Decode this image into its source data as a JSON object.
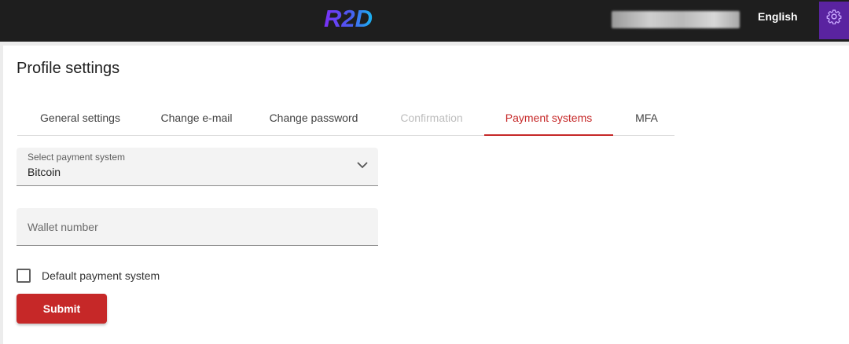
{
  "header": {
    "logo_text": "R2D",
    "language": "English",
    "settings_icon": "gear-icon",
    "accent_color": "#5a23a0"
  },
  "page": {
    "title": "Profile settings"
  },
  "tabs": [
    {
      "label": "General settings",
      "state": "normal"
    },
    {
      "label": "Change e-mail",
      "state": "normal"
    },
    {
      "label": "Change password",
      "state": "normal"
    },
    {
      "label": "Confirmation",
      "state": "disabled"
    },
    {
      "label": "Payment systems",
      "state": "active"
    },
    {
      "label": "MFA",
      "state": "normal"
    }
  ],
  "form": {
    "payment_select": {
      "label": "Select payment system",
      "value": "Bitcoin"
    },
    "wallet": {
      "placeholder": "Wallet number",
      "value": ""
    },
    "default_checkbox": {
      "label": "Default payment system",
      "checked": false
    },
    "submit_label": "Submit"
  },
  "colors": {
    "primary": "#c62828",
    "topbar": "#1e1e1e"
  }
}
